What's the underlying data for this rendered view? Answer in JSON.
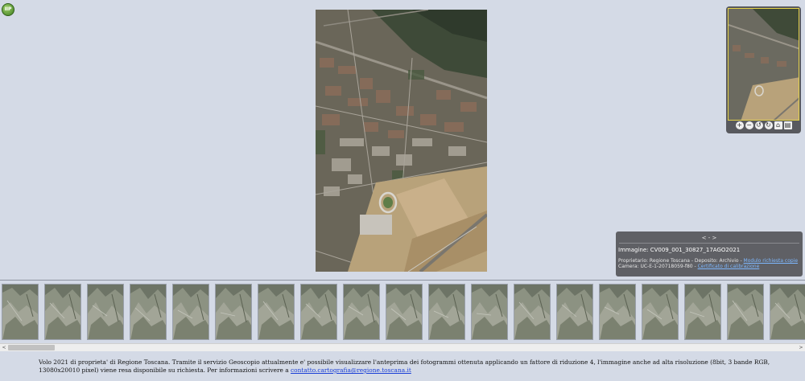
{
  "logo": {
    "text": "IIP"
  },
  "navigator": {
    "tools": [
      "zoom-in",
      "zoom-out",
      "rotate-left",
      "rotate-right",
      "home",
      "print"
    ]
  },
  "info": {
    "nav": "< - >",
    "image_label": "Immagine: CV009_001_30827_17AGO2021",
    "owner_prefix": "Proprietario: Regione Toscana - Deposito: Archivio - ",
    "owner_link": "Modulo richiesta copie",
    "camera_prefix": "Camera: UC-E-1-20718059-f80 - ",
    "camera_link": "Certificato di calibrazione"
  },
  "thumbnails": {
    "count": 19
  },
  "scrollbar": {
    "left_arrow": "<",
    "right_arrow": ">"
  },
  "caption": {
    "text": "Volo 2021 di proprieta' di Regione Toscana. Tramite il servizio Geoscopio attualmente e' possibile visualizzare l'anteprima dei fotogrammi ottenuta applicando un fattore di riduzione 4, l'immagine anche ad alta risoluzione (8bit, 3 bande RGB, 13080x20010 pixel) viene resa disponibile su richiesta. Per informazioni scrivere a ",
    "email": "contatto.cartografia@regione.toscana.it"
  },
  "colors": {
    "background": "#d4dae6",
    "panel": "#5f6065",
    "link": "#1a3fd6"
  }
}
